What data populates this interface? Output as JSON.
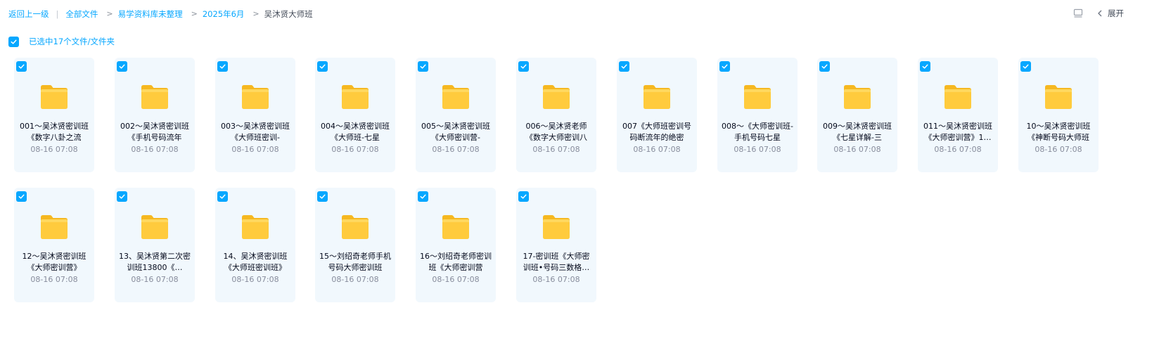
{
  "breadcrumb": {
    "back": "返回上一级",
    "separator_pipe": "|",
    "separator_arrow": ">",
    "items": [
      "全部文件",
      "易学资料库未整理",
      "2025年6月"
    ],
    "current": "吴沐贤大师班"
  },
  "toolbar": {
    "list_view_icon": "list-view-icon",
    "expand_label": "展开"
  },
  "selection": {
    "text": "已选中17个文件/文件夹",
    "all_checked": true
  },
  "colors": {
    "accent": "#06a7ff",
    "card_bg": "#f1f8fd",
    "folder": "#ffc933"
  },
  "files": [
    {
      "name": "001～吴沐贤密训班《数字八卦之流",
      "date": "08-16 07:08"
    },
    {
      "name": "002～吴沐贤密训班《手机号码流年",
      "date": "08-16 07:08"
    },
    {
      "name": "003～吴沐贤密训班《大师班密训-",
      "date": "08-16 07:08"
    },
    {
      "name": "004～吴沐贤密训班《大师班-七星",
      "date": "08-16 07:08"
    },
    {
      "name": "005～吴沐贤密训班《大师密训营-",
      "date": "08-16 07:08"
    },
    {
      "name": "006～吴沐贤老师《数字大师密训八",
      "date": "08-16 07:08"
    },
    {
      "name": "007《大师班密训号码断流年的绝密",
      "date": "08-16 07:08"
    },
    {
      "name": "008～《大师密训班-手机号码七星",
      "date": "08-16 07:08"
    },
    {
      "name": "009～吴沐贤密训班《七星详解-三",
      "date": "08-16 07:08"
    },
    {
      "name": "011～吴沐贤密训班《大师密训营》1…",
      "date": "08-16 07:08"
    },
    {
      "name": "10～吴沐贤密训班《神断号码大师班",
      "date": "08-16 07:08"
    },
    {
      "name": "12～吴沐贤密训班《大师密训营》",
      "date": "08-16 07:08"
    },
    {
      "name": "13、吴沐贤第二次密训班13800《…",
      "date": "08-16 07:08"
    },
    {
      "name": "14、吴沐贤密训班《大师班密训班》",
      "date": "08-16 07:08"
    },
    {
      "name": "15～刘绍奇老师手机号码大师密训班",
      "date": "08-16 07:08"
    },
    {
      "name": "16～刘绍奇老师密训班《大师密训营",
      "date": "08-16 07:08"
    },
    {
      "name": "17-密训班《大师密训班•号码三数格…",
      "date": "08-16 07:08"
    }
  ]
}
